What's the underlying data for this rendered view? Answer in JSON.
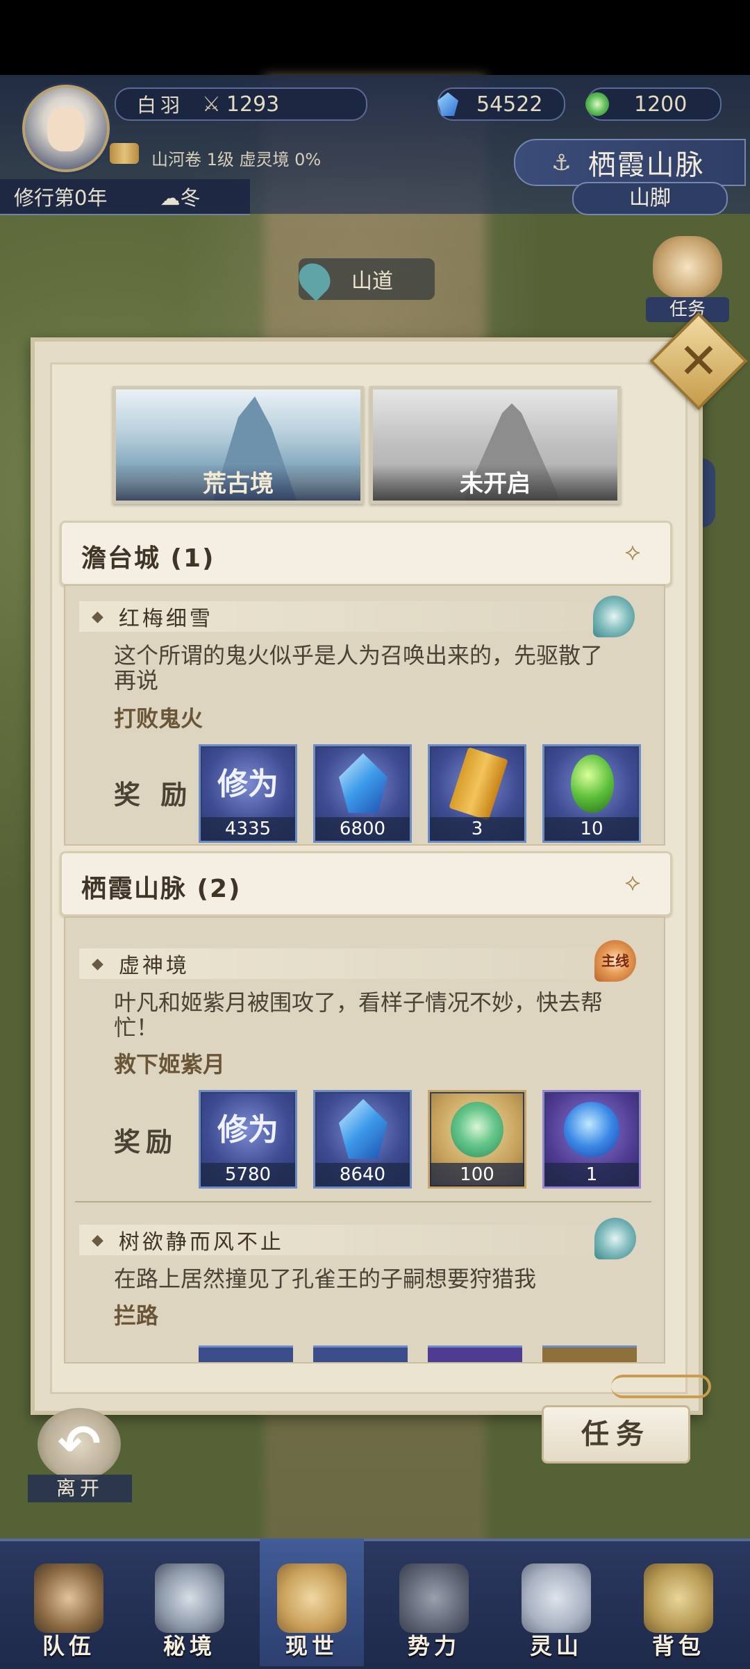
{
  "header": {
    "player_name": "白羽",
    "power": "1293",
    "spirit_stones": "54522",
    "jade": "1200",
    "scroll_info": "山河卷 1级 虚灵境 0%",
    "year": "修行第0年",
    "season": "冬",
    "location": "栖霞山脉",
    "sublocation": "山脚",
    "road_label": "山道",
    "task_side_label": "任务"
  },
  "panel": {
    "realm_tabs": [
      {
        "label": "荒古境"
      },
      {
        "label": "未开启"
      }
    ],
    "sections": [
      {
        "title": "澹台城 (1)"
      },
      {
        "title": "栖霞山脉 (2)"
      }
    ],
    "quests": [
      {
        "title": "红梅细雪",
        "desc": "这个所谓的鬼火似乎是人为召唤出来的，先驱散了再说",
        "goal": "打败鬼火",
        "reward_label": "奖 励",
        "rewards": [
          {
            "glyph": "修为",
            "count": "4335"
          },
          {
            "count": "6800"
          },
          {
            "count": "3"
          },
          {
            "count": "10"
          }
        ]
      },
      {
        "title": "虚神境",
        "badge": "主线",
        "desc": "叶凡和姬紫月被围攻了，看样子情况不妙，快去帮忙！",
        "goal": "救下姬紫月",
        "reward_label": "奖励",
        "rewards": [
          {
            "glyph": "修为",
            "count": "5780"
          },
          {
            "count": "8640"
          },
          {
            "count": "100"
          },
          {
            "count": "1"
          }
        ]
      },
      {
        "title": "树欲静而风不止",
        "desc": "在路上居然撞见了孔雀王的子嗣想要狩猎我",
        "goal": "拦路"
      }
    ]
  },
  "buttons": {
    "task": "任务",
    "leave": "离开"
  },
  "bottom_nav": [
    {
      "label": "队伍"
    },
    {
      "label": "秘境"
    },
    {
      "label": "现世"
    },
    {
      "label": "势力"
    },
    {
      "label": "灵山"
    },
    {
      "label": "背包"
    }
  ]
}
